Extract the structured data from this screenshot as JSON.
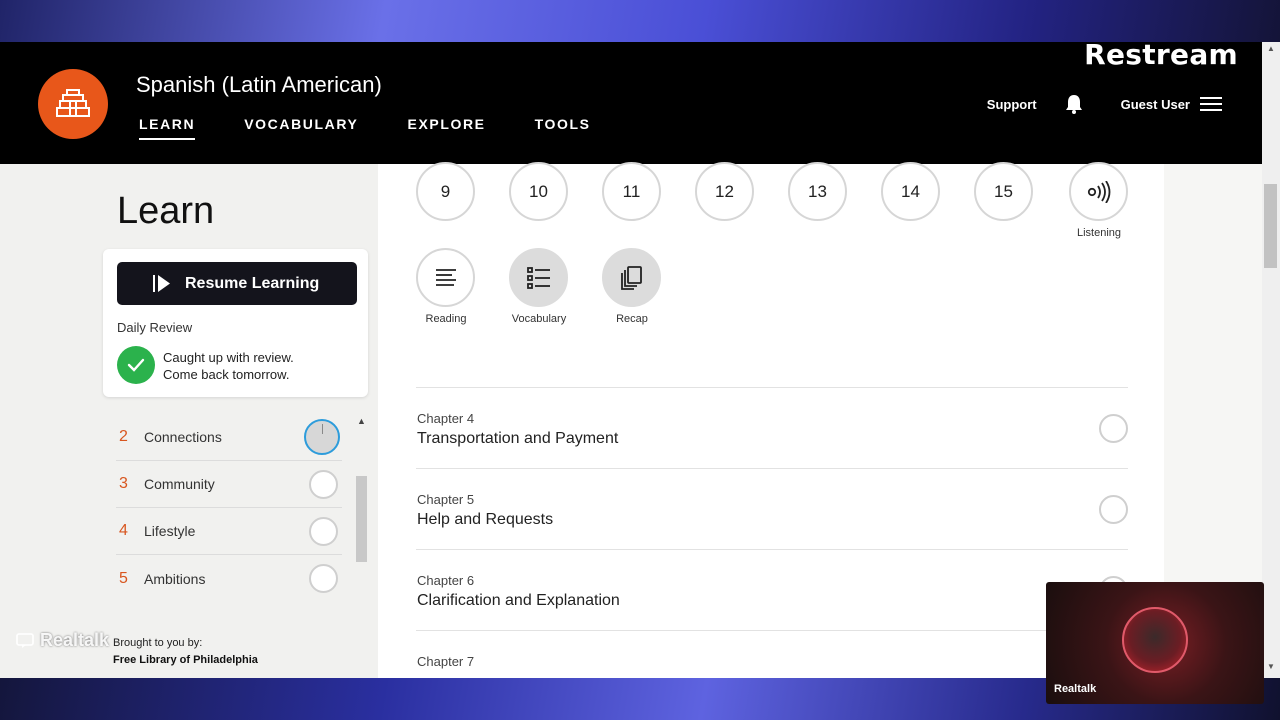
{
  "overlay": {
    "restream_logo": "Restream",
    "watermark": "Realtalk",
    "cam_name": "Realtalk"
  },
  "header": {
    "title": "Spanish (Latin American)",
    "nav": [
      {
        "label": "LEARN",
        "active": true
      },
      {
        "label": "VOCABULARY",
        "active": false
      },
      {
        "label": "EXPLORE",
        "active": false
      },
      {
        "label": "TOOLS",
        "active": false
      }
    ],
    "support": "Support",
    "user": "Guest User"
  },
  "sidebar": {
    "title": "Learn",
    "resume_label": "Resume Learning",
    "daily_review_label": "Daily Review",
    "review_message_line1": "Caught up with review.",
    "review_message_line2": "Come back tomorrow.",
    "units": [
      {
        "num": "2",
        "name": "Connections",
        "active": true
      },
      {
        "num": "3",
        "name": "Community",
        "active": false
      },
      {
        "num": "4",
        "name": "Lifestyle",
        "active": false
      },
      {
        "num": "5",
        "name": "Ambitions",
        "active": false
      }
    ],
    "brought_by": "Brought to you by:",
    "library": "Free Library of Philadelphia"
  },
  "main": {
    "lessons": [
      "9",
      "10",
      "11",
      "12",
      "13",
      "14",
      "15"
    ],
    "listening_label": "Listening",
    "resources": [
      {
        "label": "Reading",
        "icon": "reading-icon"
      },
      {
        "label": "Vocabulary",
        "icon": "vocabulary-icon"
      },
      {
        "label": "Recap",
        "icon": "recap-icon"
      }
    ],
    "chapters": [
      {
        "num": "Chapter 4",
        "title": "Transportation and Payment"
      },
      {
        "num": "Chapter 5",
        "title": "Help and Requests"
      },
      {
        "num": "Chapter 6",
        "title": "Clarification and Explanation"
      },
      {
        "num": "Chapter 7",
        "title": ""
      }
    ]
  },
  "colors": {
    "accent": "#e8571a",
    "header_bg": "#000000",
    "success": "#2bb24c",
    "active_ring": "#2d9cdb"
  }
}
